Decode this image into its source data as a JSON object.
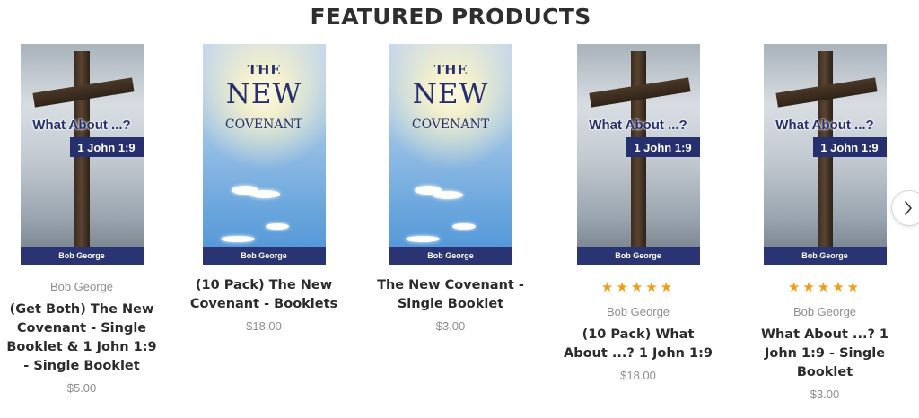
{
  "section": {
    "title": "FEATURED PRODUCTS"
  },
  "colors": {
    "accent_star": "#f39c12",
    "cover_blue": "#27306e"
  },
  "products": [
    {
      "cover": {
        "type": "cross",
        "headline": "What About ...?",
        "reference": "1 John 1:9",
        "author_bar": "Bob George"
      },
      "rating": null,
      "author": "Bob George",
      "name": "(Get Both) The New Covenant - Single Booklet & 1 John 1:9 - Single Booklet",
      "price": "$5.00"
    },
    {
      "cover": {
        "type": "covenant",
        "the": "THE",
        "new": "NEW",
        "covenant": "COVENANT",
        "author_bar": "Bob George"
      },
      "rating": null,
      "author": null,
      "name": "(10 Pack) The New Covenant - Booklets",
      "price": "$18.00"
    },
    {
      "cover": {
        "type": "covenant",
        "the": "THE",
        "new": "NEW",
        "covenant": "COVENANT",
        "author_bar": "Bob George"
      },
      "rating": null,
      "author": null,
      "name": "The New Covenant - Single Booklet",
      "price": "$3.00"
    },
    {
      "cover": {
        "type": "cross",
        "headline": "What About ...?",
        "reference": "1 John 1:9",
        "author_bar": "Bob George"
      },
      "rating": {
        "stars": "★★★★★",
        "value": 5,
        "max": 5
      },
      "author": "Bob George",
      "name": "(10 Pack) What About ...? 1 John 1:9",
      "price": "$18.00"
    },
    {
      "cover": {
        "type": "cross",
        "headline": "What About ...?",
        "reference": "1 John 1:9",
        "author_bar": "Bob George"
      },
      "rating": {
        "stars": "★★★★★",
        "value": 5,
        "max": 5
      },
      "author": "Bob George",
      "name": "What About ...? 1 John 1:9 - Single Booklet",
      "price": "$3.00"
    }
  ],
  "carousel": {
    "next_icon": "chevron-right-icon"
  }
}
